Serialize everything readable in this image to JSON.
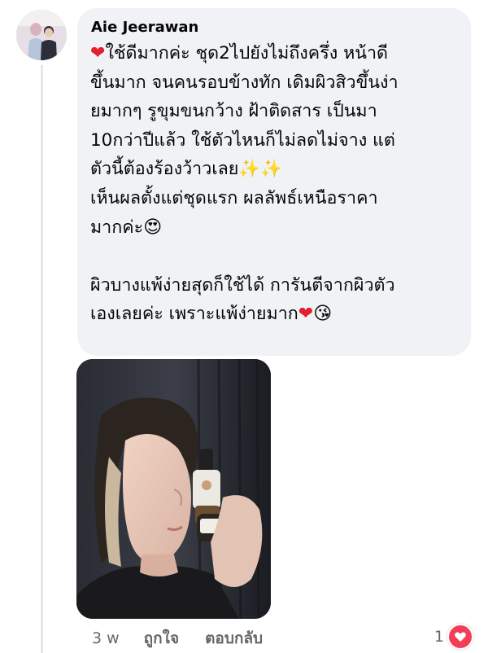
{
  "comment": {
    "author": "Aie Jeerawan",
    "lines": [
      "ใช้ดีมากค่ะ ชุด2ไปยังไม่ถึงครึ่ง หน้าดี",
      "ขึ้นมาก จนคนรอบข้างทัก เดิมผิวสิวขึ้นง่า",
      "ยมากๆ รูขุมขนกว้าง ฝ้าติดสาร เป็นมา",
      "10กว่าปีแล้ว ใช้ตัวไหนก็ไม่ลดไม่จาง แต่",
      "ตัวนี้ต้องร้องว้าวเลย",
      "เห็นผลตั้งแต่ชุดแรก ผลลัพธ์เหนือราคา",
      "มากค่ะ",
      "",
      "ผิวบางแพ้ง่ายสุดก็ใช้ได้ การันตีจากผิวตัว",
      "เองเลยค่ะ เพราะแพ้ง่ายมาก"
    ],
    "emoji": {
      "heart": "❤",
      "sparkles": "✨✨",
      "heart_eyes": "😍",
      "kiss": "😘"
    }
  },
  "actions": {
    "time": "3 w",
    "like": "ถูกใจ",
    "reply": "ตอบกลับ"
  },
  "reactions": {
    "count": "1",
    "type_icon": "heart-reaction-icon"
  },
  "colors": {
    "bubble": "#f0f2f5",
    "meta_text": "#65676b",
    "heart_red": "#f33e58"
  }
}
